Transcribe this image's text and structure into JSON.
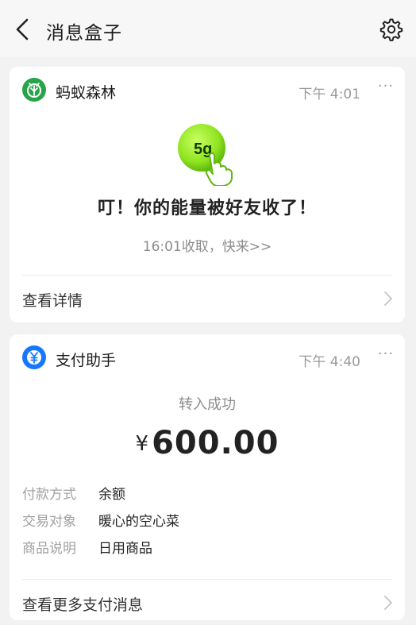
{
  "header": {
    "title": "消息盒子",
    "back_icon": "chevron-left-icon",
    "settings_icon": "gear-icon"
  },
  "messages": [
    {
      "app_name": "蚂蚁森林",
      "app_icon": "ant-forest-icon",
      "app_color": "#27a44a",
      "time": "下午 4:01",
      "more": "···",
      "energy_label": "5g",
      "headline": "叮！你的能量被好友收了！",
      "subline": "16:01收取，快来>>",
      "action_label": "查看详情"
    },
    {
      "app_name": "支付助手",
      "app_icon": "yuan-icon",
      "app_color": "#1677ff",
      "time": "下午 4:40",
      "more": "···",
      "status": "转入成功",
      "currency": "¥",
      "amount": "600.00",
      "details": [
        {
          "label": "付款方式",
          "value": "余额"
        },
        {
          "label": "交易对象",
          "value": "暖心的空心菜"
        },
        {
          "label": "商品说明",
          "value": "日用商品"
        }
      ],
      "action_label": "查看更多支付消息"
    }
  ],
  "colors": {
    "background": "#f2f2f2",
    "energy_green": "#8fe31f"
  }
}
